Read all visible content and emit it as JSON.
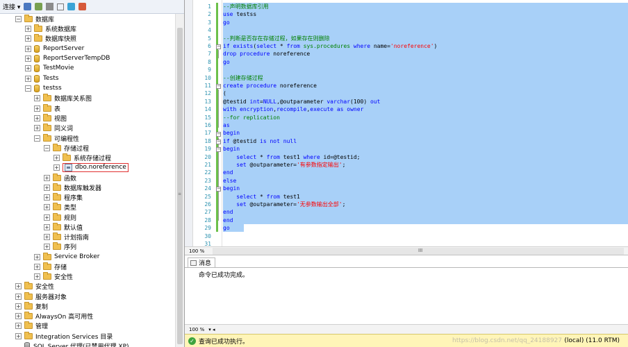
{
  "object_explorer": {
    "toolbar": {
      "connect_label": "连接 ▾"
    },
    "tree": [
      {
        "label": "数据库",
        "expander": "−"
      },
      {
        "label": "系统数据库",
        "expander": "+"
      },
      {
        "label": "数据库快照",
        "expander": "+"
      },
      {
        "label": "ReportServer",
        "expander": "+"
      },
      {
        "label": "ReportServerTempDB",
        "expander": "+"
      },
      {
        "label": "TestMovie",
        "expander": "+"
      },
      {
        "label": "Tests",
        "expander": "+"
      },
      {
        "label": "testss",
        "expander": "−"
      },
      {
        "label": "数据库关系图",
        "expander": "+"
      },
      {
        "label": "表",
        "expander": "+"
      },
      {
        "label": "视图",
        "expander": "+"
      },
      {
        "label": "同义词",
        "expander": "+"
      },
      {
        "label": "可编程性",
        "expander": "−"
      },
      {
        "label": "存储过程",
        "expander": "−"
      },
      {
        "label": "系统存储过程",
        "expander": "+"
      },
      {
        "label": "dbo.noreference",
        "expander": "+"
      },
      {
        "label": "函数",
        "expander": "+"
      },
      {
        "label": "数据库触发器",
        "expander": "+"
      },
      {
        "label": "程序集",
        "expander": "+"
      },
      {
        "label": "类型",
        "expander": "+"
      },
      {
        "label": "规则",
        "expander": "+"
      },
      {
        "label": "默认值",
        "expander": "+"
      },
      {
        "label": "计划指南",
        "expander": "+"
      },
      {
        "label": "序列",
        "expander": "+"
      },
      {
        "label": "Service Broker",
        "expander": "+"
      },
      {
        "label": "存储",
        "expander": "+"
      },
      {
        "label": "安全性",
        "expander": "+"
      },
      {
        "label": "安全性",
        "expander": "+"
      },
      {
        "label": "服务器对象",
        "expander": "+"
      },
      {
        "label": "复制",
        "expander": "+"
      },
      {
        "label": "AlwaysOn 高可用性",
        "expander": "+"
      },
      {
        "label": "管理",
        "expander": "+"
      },
      {
        "label": "Integration Services 目录",
        "expander": "+"
      },
      {
        "label": "SQL Server 代理(已禁用代理 XP)",
        "expander": ""
      }
    ]
  },
  "editor": {
    "line_numbers": [
      "1",
      "2",
      "3",
      "4",
      "5",
      "6",
      "7",
      "8",
      "9",
      "10",
      "11",
      "12",
      "13",
      "14",
      "15",
      "16",
      "17",
      "18",
      "19",
      "20",
      "21",
      "22",
      "23",
      "24",
      "25",
      "26",
      "27",
      "28",
      "29",
      "30",
      "31"
    ],
    "code_lines": [
      "--声明数据库引用",
      "use testss",
      "go",
      "",
      "--判断是否存在存储过程，如果存在则删除",
      "if exists(select * from sys.procedures where name='noreference')",
      "drop procedure noreference",
      "go",
      "",
      "--创建存储过程",
      "create procedure noreference",
      "(",
      "@testid int=NULL,@outparameter varchar(100) out",
      "with encryption,recompile,execute as owner",
      "--for replication",
      "as",
      "begin",
      "if @testid is not null",
      "begin",
      "    select * from test1 where id=@testid;",
      "    set @outparameter='有参数指定输出';",
      "end",
      "else",
      "begin",
      "    select * from test1",
      "    set @outparameter='无参数输出全部';",
      "end",
      "end",
      "go",
      "",
      ""
    ],
    "zoom": "100 %",
    "hscroll_grip": "III"
  },
  "results": {
    "tab_label": "消息",
    "message": "命令已成功完成。",
    "zoom": "100 %"
  },
  "statusbar": {
    "text": "查询已成功执行。",
    "watermark": "https://blog.csdn.net/qq_24188927",
    "server": "(local) (11.0 RTM)"
  },
  "colors": {
    "selection": "#a8d0f8",
    "keyword": "#0000ff",
    "string": "#ff0000",
    "comment": "#008000",
    "statusbar": "#fff5b8"
  }
}
